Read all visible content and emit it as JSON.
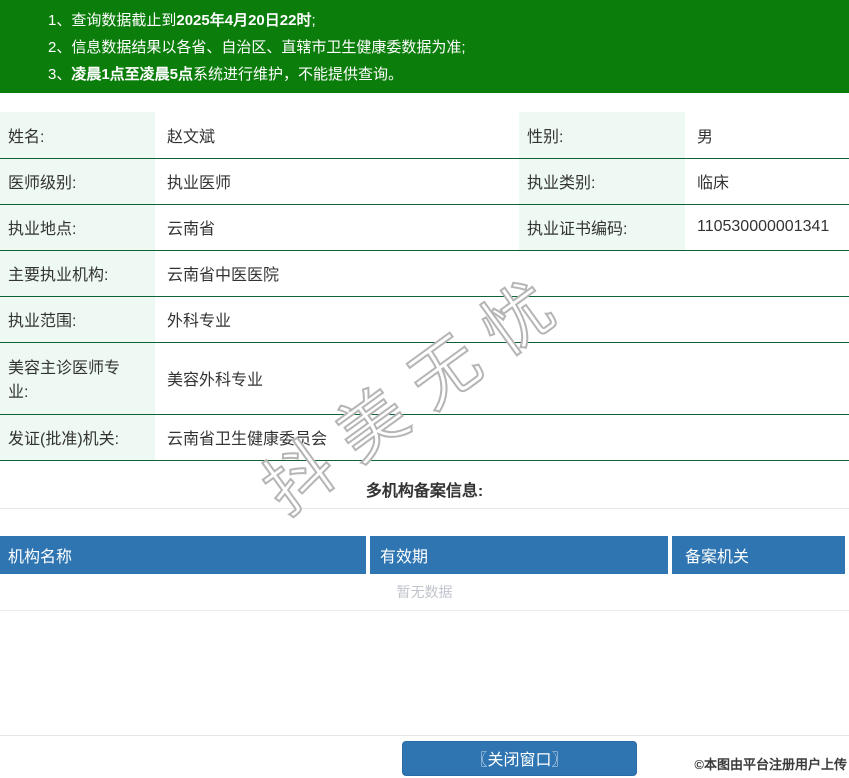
{
  "notice": {
    "lines": [
      {
        "num": "1、",
        "prefix": "查询数据截止到",
        "bold": "2025年4月20日22时",
        "suffix": ";"
      },
      {
        "num": "2、",
        "prefix": "信息数据结果以各省、自治区、直辖市卫生健康委数据为准;",
        "bold": "",
        "suffix": ""
      },
      {
        "num": "3、",
        "prefix": "",
        "bold": "凌晨1点至凌晨5点",
        "suffix": "系统进行维护，不能提供查询。"
      }
    ]
  },
  "details": {
    "rows": [
      {
        "cells": [
          {
            "label": "姓名:",
            "value": "赵文斌"
          },
          {
            "label": "性别:",
            "value": "男"
          }
        ]
      },
      {
        "cells": [
          {
            "label": "医师级别:",
            "value": "执业医师"
          },
          {
            "label": "执业类别:",
            "value": "临床"
          }
        ]
      },
      {
        "cells": [
          {
            "label": "执业地点:",
            "value": "云南省"
          },
          {
            "label": "执业证书编码:",
            "value": "110530000001341"
          }
        ]
      },
      {
        "cells": [
          {
            "label": "主要执业机构:",
            "value": "云南省中医医院"
          }
        ]
      },
      {
        "cells": [
          {
            "label": "执业范围:",
            "value": "外科专业"
          }
        ]
      },
      {
        "cells": [
          {
            "label": "美容主诊医师专业:",
            "value": "美容外科专业"
          }
        ]
      },
      {
        "cells": [
          {
            "label": "发证(批准)机关:",
            "value": "云南省卫生健康委员会"
          }
        ]
      }
    ]
  },
  "filing": {
    "section_title": "多机构备案信息:",
    "columns": [
      "机构名称",
      "有效期",
      "备案机关"
    ],
    "empty_text": "暂无数据"
  },
  "footer": {
    "close_button_label": "〖关闭窗口〗",
    "caption": "©本图由平台注册用户上传"
  },
  "watermark": {
    "text": "抖美无忧"
  },
  "theme": {
    "notice_green": "#0b7d0b",
    "row_border_green": "#0e6334",
    "label_cell_mint": "#edf9f2",
    "table_header_blue": "#2e75b1",
    "button_blue": "#2e75b1",
    "empty_text_gray": "#c0c4cc"
  }
}
